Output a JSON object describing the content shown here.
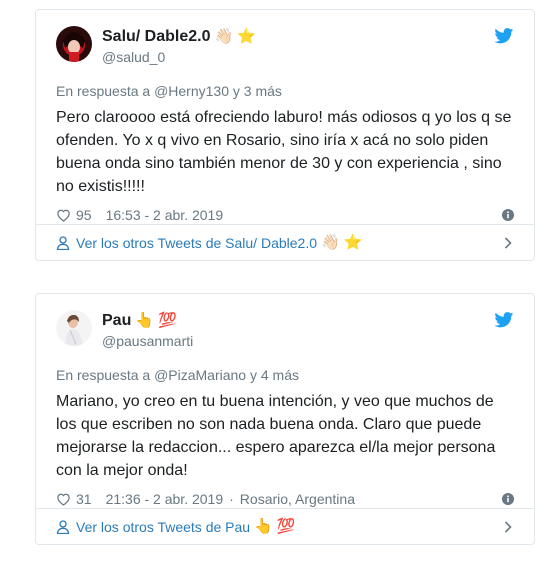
{
  "tweets": [
    {
      "display_name": "Salu/ Dable2.0",
      "name_emojis": [
        "👋🏻",
        "⭐"
      ],
      "handle": "@salud_0",
      "reply_prefix": "En respuesta a ",
      "reply_to": "@Herny130",
      "reply_suffix": " y 3 más",
      "text": "Pero claroooo está ofreciendo laburo! más odiosos q yo los q se ofenden. Yo x q vivo en Rosario, sino iría x acá no solo piden buena onda sino también menor de 30 y con experiencia , sino no existis!!!!!",
      "likes": "95",
      "time": "16:53 - 2 abr. 2019",
      "location": "",
      "footer_label": "Ver los otros Tweets de Salu/ Dable2.0",
      "footer_emojis": [
        "👋🏻",
        "⭐"
      ]
    },
    {
      "display_name": "Pau",
      "name_emojis": [
        "👆",
        "💯"
      ],
      "handle": "@pausanmarti",
      "reply_prefix": "En respuesta a ",
      "reply_to": "@PizaMariano",
      "reply_suffix": " y 4 más",
      "text": "Mariano, yo creo en tu buena intención, y veo que muchos de los que escriben no son nada buena onda. Claro que puede mejorarse la redaccion... espero aparezca el/la mejor persona con la mejor onda!",
      "likes": "31",
      "time": "21:36 - 2 abr. 2019",
      "location": "Rosario, Argentina",
      "footer_label": "Ver los otros Tweets de Pau",
      "footer_emojis": [
        "👆",
        "💯"
      ]
    }
  ],
  "icons": {
    "bird": "twitter-bird-icon",
    "heart": "heart-icon",
    "info": "info-icon",
    "person": "person-icon",
    "chevron": "chevron-right-icon"
  },
  "colors": {
    "twitter_blue": "#1da1f2",
    "link_blue": "#2b7bb9",
    "meta_gray": "#697882",
    "border": "#e1e8ed"
  }
}
